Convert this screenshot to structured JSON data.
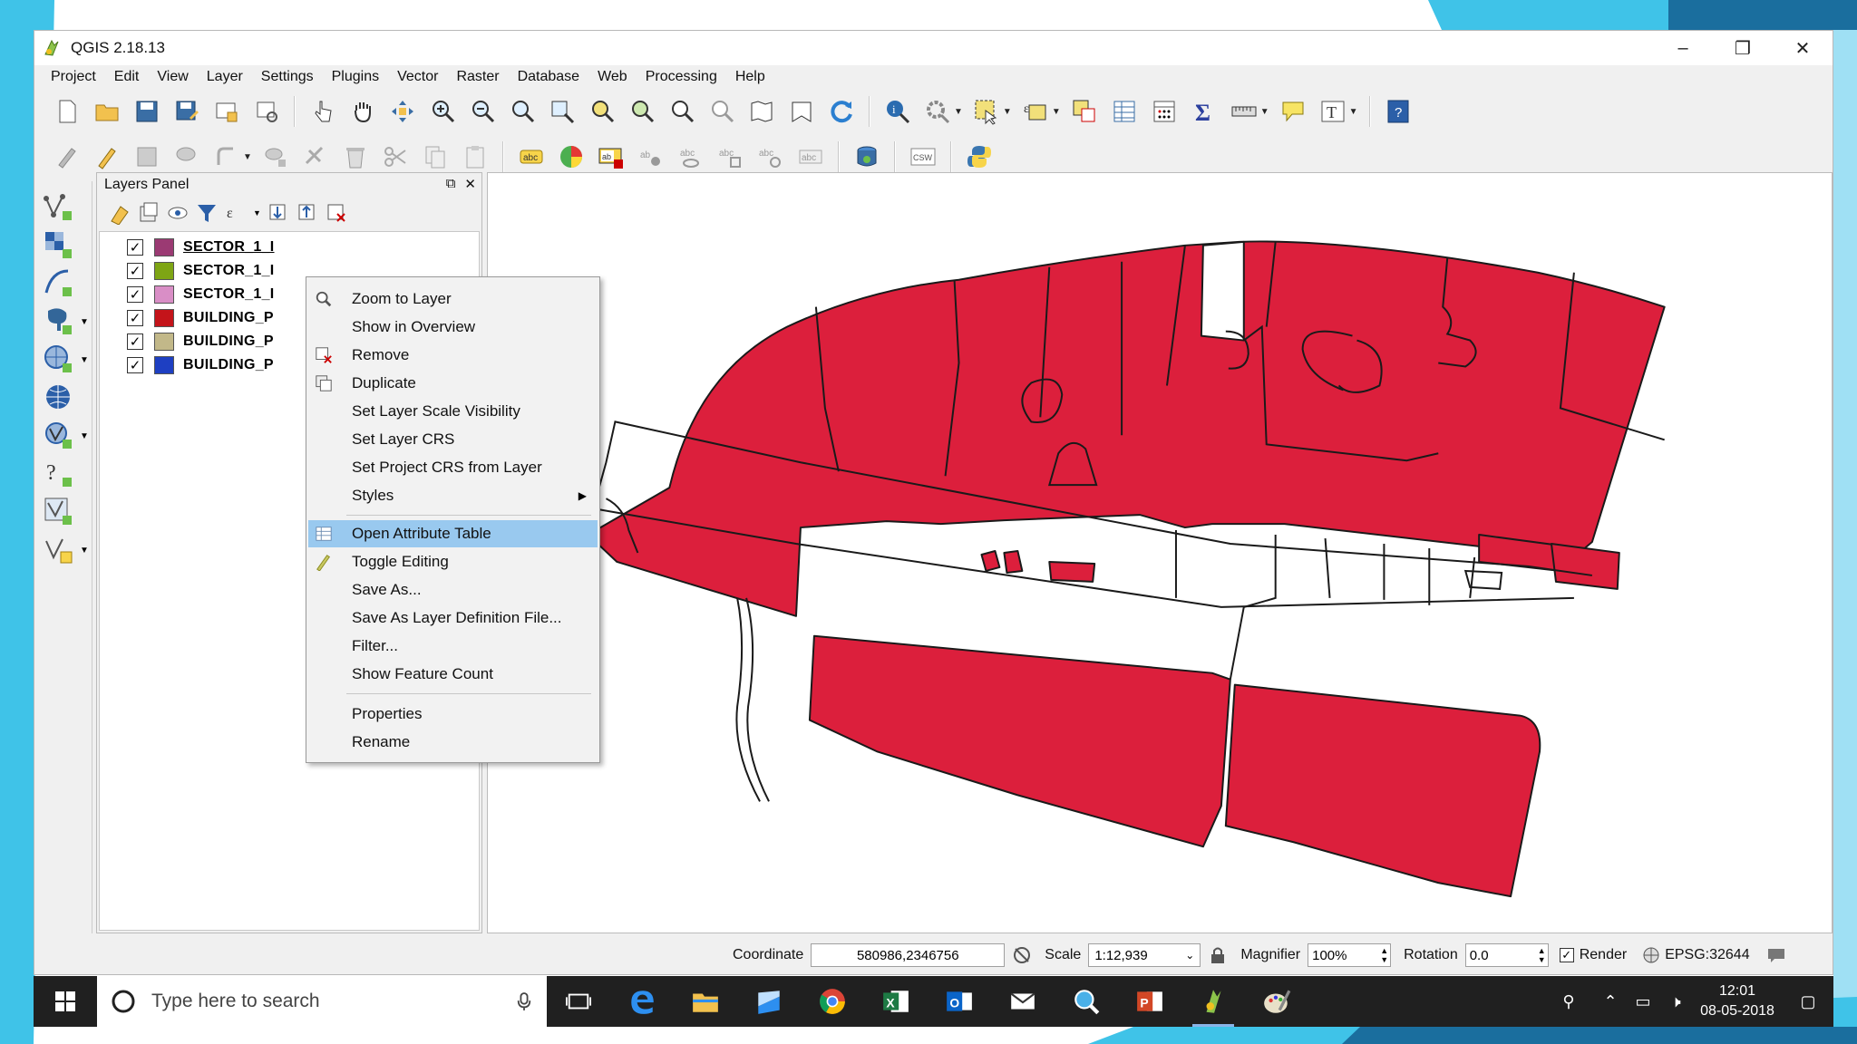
{
  "window": {
    "title": "QGIS 2.18.13",
    "controls": {
      "minimize": "–",
      "restore": "❐",
      "close": "✕"
    }
  },
  "menu": [
    "Project",
    "Edit",
    "View",
    "Layer",
    "Settings",
    "Plugins",
    "Vector",
    "Raster",
    "Database",
    "Web",
    "Processing",
    "Help"
  ],
  "layers_panel": {
    "title": "Layers Panel",
    "layers": [
      {
        "name": "SECTOR_1_I",
        "color": "#9b3a73",
        "checked": true,
        "selected": true
      },
      {
        "name": "SECTOR_1_I",
        "color": "#7ea514",
        "checked": true,
        "selected": false
      },
      {
        "name": "SECTOR_1_I",
        "color": "#d98ec6",
        "checked": true,
        "selected": false
      },
      {
        "name": "BUILDING_P",
        "color": "#c4141a",
        "checked": true,
        "selected": false
      },
      {
        "name": "BUILDING_P",
        "color": "#c2b889",
        "checked": true,
        "selected": false
      },
      {
        "name": "BUILDING_P",
        "color": "#1e3fc2",
        "checked": true,
        "selected": false
      }
    ]
  },
  "context_menu": {
    "items": [
      {
        "label": "Zoom to Layer",
        "icon": "zoom-icon",
        "highlighted": false,
        "submenu": false
      },
      {
        "label": "Show in Overview",
        "icon": "",
        "highlighted": false,
        "submenu": false
      },
      {
        "label": "Remove",
        "icon": "remove-layer-icon",
        "highlighted": false,
        "submenu": false
      },
      {
        "label": "Duplicate",
        "icon": "duplicate-icon",
        "highlighted": false,
        "submenu": false
      },
      {
        "label": "Set Layer Scale Visibility",
        "icon": "",
        "highlighted": false,
        "submenu": false
      },
      {
        "label": "Set Layer CRS",
        "icon": "",
        "highlighted": false,
        "submenu": false
      },
      {
        "label": "Set Project CRS from Layer",
        "icon": "",
        "highlighted": false,
        "submenu": false
      },
      {
        "label": "Styles",
        "icon": "",
        "highlighted": false,
        "submenu": true
      },
      {
        "label": "Open Attribute Table",
        "icon": "table-icon",
        "highlighted": true,
        "submenu": false
      },
      {
        "label": "Toggle Editing",
        "icon": "pencil-icon",
        "highlighted": false,
        "submenu": false
      },
      {
        "label": "Save As...",
        "icon": "",
        "highlighted": false,
        "submenu": false
      },
      {
        "label": "Save As Layer Definition File...",
        "icon": "",
        "highlighted": false,
        "submenu": false
      },
      {
        "label": "Filter...",
        "icon": "",
        "highlighted": false,
        "submenu": false
      },
      {
        "label": "Show Feature Count",
        "icon": "",
        "highlighted": false,
        "submenu": false
      },
      {
        "label": "Properties",
        "icon": "",
        "highlighted": false,
        "submenu": false
      },
      {
        "label": "Rename",
        "icon": "",
        "highlighted": false,
        "submenu": false
      }
    ]
  },
  "map": {
    "fill_color": "#dc1f3c",
    "stroke_color": "#1a1a1a"
  },
  "statusbar": {
    "coordinate_label": "Coordinate",
    "coordinate_value": "580986,2346756",
    "scale_label": "Scale",
    "scale_value": "1:12,939",
    "magnifier_label": "Magnifier",
    "magnifier_value": "100%",
    "rotation_label": "Rotation",
    "rotation_value": "0.0",
    "render_label": "Render",
    "render_checked": true,
    "crs_label": "EPSG:32644"
  },
  "taskbar": {
    "search_placeholder": "Type here to search",
    "time": "12:01",
    "date": "08-05-2018"
  },
  "colors": {
    "accent_blue": "#99c9ef",
    "slide_cyan": "#3fc3e8",
    "slide_dark": "#1a6e9e"
  }
}
